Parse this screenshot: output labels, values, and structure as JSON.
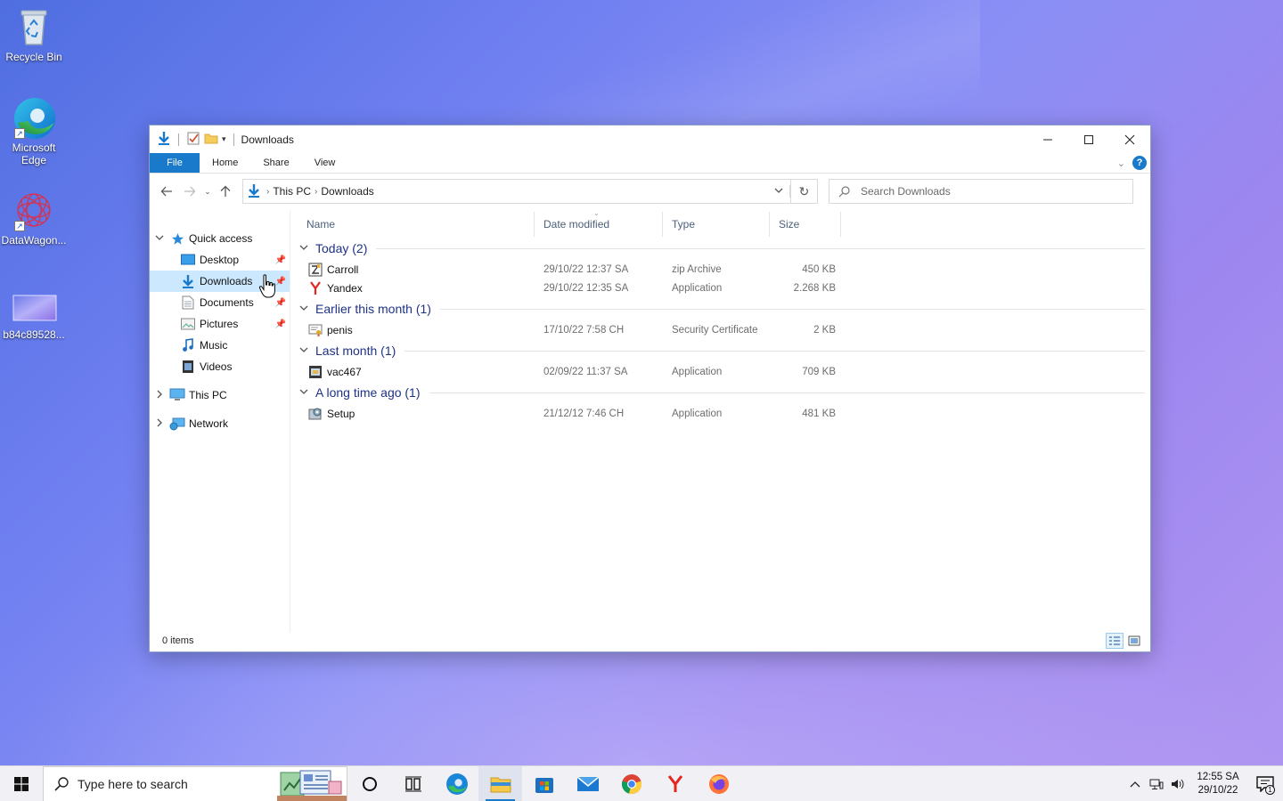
{
  "desktop": {
    "icons": [
      {
        "label": "Recycle Bin"
      },
      {
        "label": "Microsoft Edge"
      },
      {
        "label": "DataWagon..."
      },
      {
        "label": "b84c89528..."
      }
    ]
  },
  "window": {
    "title": "Downloads",
    "ribbon_tabs": [
      "File",
      "Home",
      "Share",
      "View"
    ],
    "address": {
      "crumbs": [
        "This PC",
        "Downloads"
      ]
    },
    "search_placeholder": "Search Downloads",
    "nav_pane": {
      "quick_access": "Quick access",
      "items": [
        {
          "label": "Desktop",
          "pinned": true
        },
        {
          "label": "Downloads",
          "pinned": true,
          "selected": true
        },
        {
          "label": "Documents",
          "pinned": true
        },
        {
          "label": "Pictures",
          "pinned": true
        },
        {
          "label": "Music",
          "pinned": false
        },
        {
          "label": "Videos",
          "pinned": false
        }
      ],
      "this_pc": "This PC",
      "network": "Network"
    },
    "columns": {
      "name": "Name",
      "date": "Date modified",
      "type": "Type",
      "size": "Size"
    },
    "groups": [
      {
        "header": "Today (2)",
        "files": [
          {
            "name": "Carroll",
            "date": "29/10/22 12:37 SA",
            "type": "zip Archive",
            "size": "450 KB",
            "icon": "zip-archive-icon"
          },
          {
            "name": "Yandex",
            "date": "29/10/22 12:35 SA",
            "type": "Application",
            "size": "2.268 KB",
            "icon": "yandex-icon"
          }
        ]
      },
      {
        "header": "Earlier this month (1)",
        "files": [
          {
            "name": "penis",
            "date": "17/10/22 7:58 CH",
            "type": "Security Certificate",
            "size": "2 KB",
            "icon": "certificate-icon"
          }
        ]
      },
      {
        "header": "Last month (1)",
        "files": [
          {
            "name": "vac467",
            "date": "02/09/22 11:37 SA",
            "type": "Application",
            "size": "709 KB",
            "icon": "application-icon"
          }
        ]
      },
      {
        "header": "A long time ago (1)",
        "files": [
          {
            "name": "Setup",
            "date": "21/12/12 7:46 CH",
            "type": "Application",
            "size": "481 KB",
            "icon": "setup-icon"
          }
        ]
      }
    ],
    "status": "0 items"
  },
  "taskbar": {
    "search_placeholder": "Type here to search",
    "clock_time": "12:55 SA",
    "clock_date": "29/10/22",
    "notification_count": "1",
    "accent": "#1979ca"
  }
}
